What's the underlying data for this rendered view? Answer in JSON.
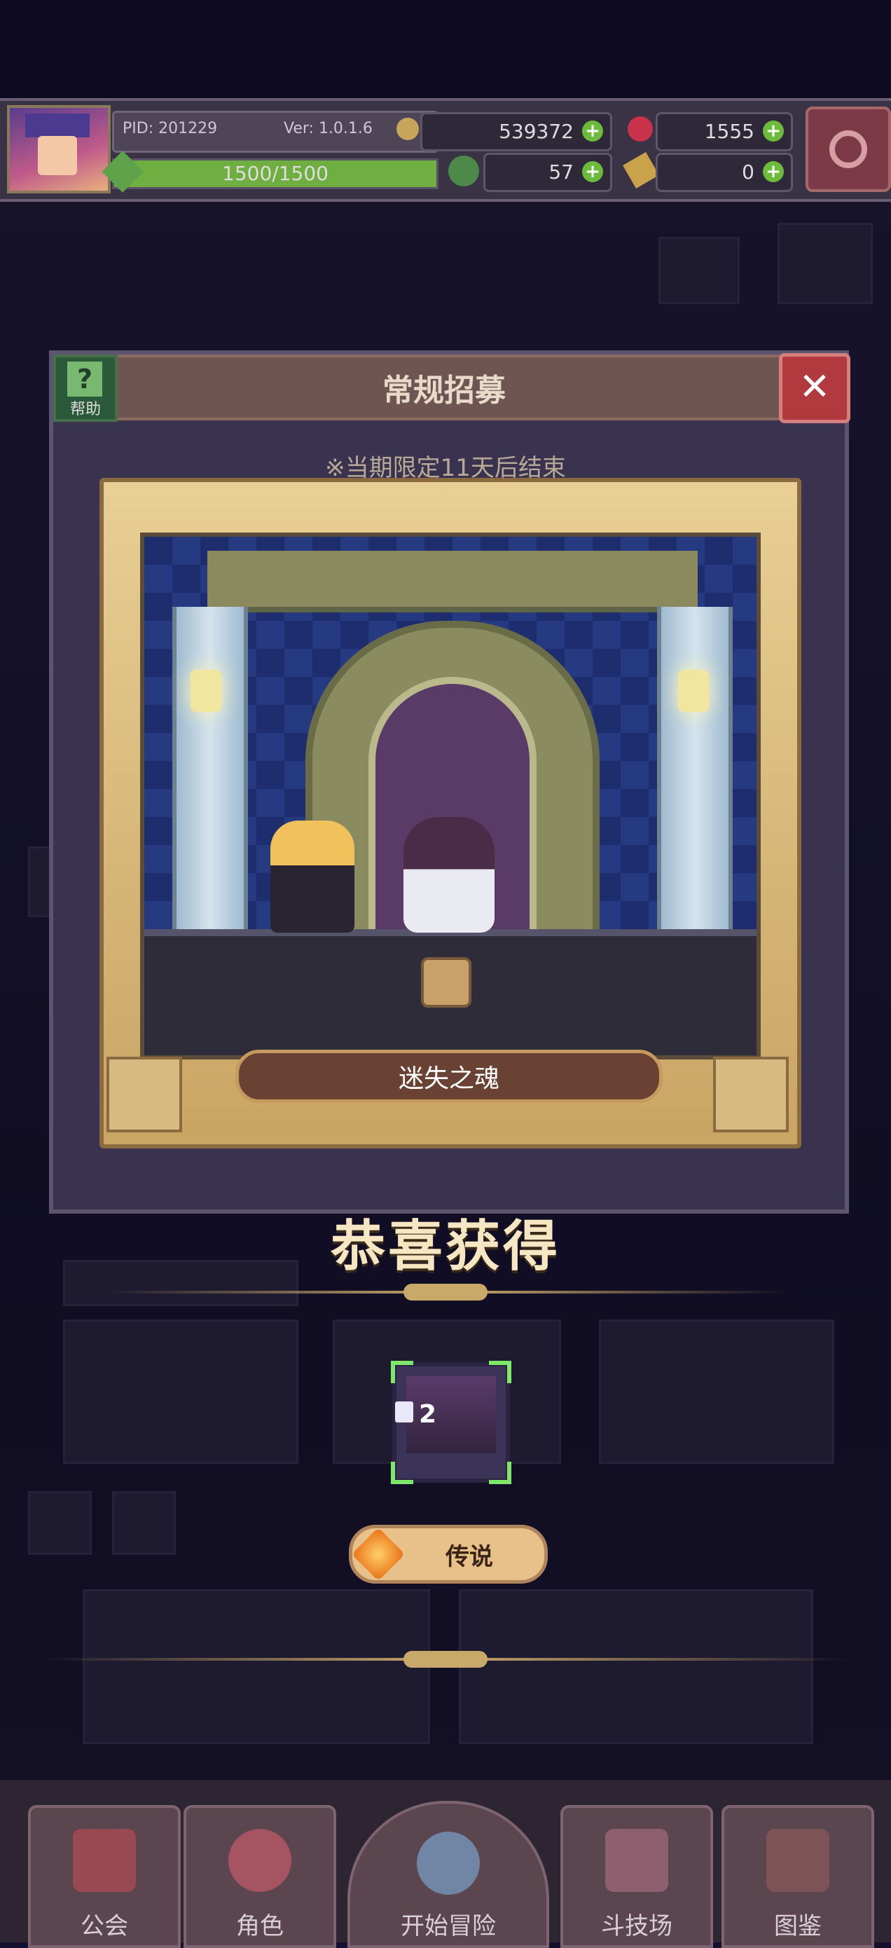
{
  "hud": {
    "pid": "PID: 201229",
    "version": "Ver: 1.0.1.6",
    "gold": "539372",
    "gems": "1555",
    "energy": "1500/1500",
    "energy_fraction": 1.0,
    "clover": "57",
    "keys": "0"
  },
  "popup": {
    "help_label": "帮助",
    "title": "常规招募",
    "notice": "※当期限定11天后结束",
    "featured_name": "迷失之魂"
  },
  "result": {
    "congrats": "恭喜获得",
    "reward_count": "2",
    "rarity": "传说"
  },
  "bottom_nav": [
    {
      "label": "公会"
    },
    {
      "label": "角色"
    },
    {
      "label": "开始冒险"
    },
    {
      "label": "斗技场"
    },
    {
      "label": "图鉴"
    }
  ],
  "colors": {
    "gold_frame": "#e8cf95",
    "accent_green": "#7ee86a",
    "legend_orange": "#e86c12",
    "background": "#141130"
  }
}
